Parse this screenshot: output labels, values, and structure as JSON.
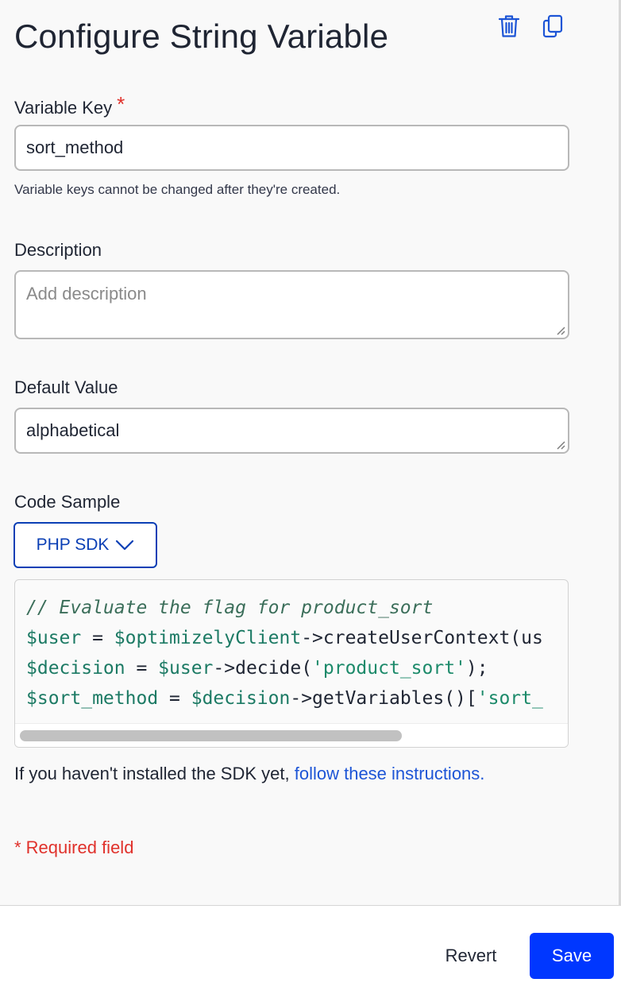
{
  "header": {
    "title": "Configure String Variable",
    "delete_icon": "trash-icon",
    "copy_icon": "copy-icon"
  },
  "variable_key": {
    "label": "Variable Key",
    "required_marker": "*",
    "value": "sort_method",
    "help_text": "Variable keys cannot be changed after they're created."
  },
  "description": {
    "label": "Description",
    "placeholder": "Add description"
  },
  "default_value": {
    "label": "Default Value",
    "value": "alphabetical"
  },
  "code_sample": {
    "label": "Code Sample",
    "sdk_selected": "PHP SDK",
    "lines": [
      [
        {
          "t": "c",
          "text": "// Evaluate the flag for product_sort"
        }
      ],
      [
        {
          "t": "v",
          "text": "$user"
        },
        {
          "t": "p",
          "text": " = "
        },
        {
          "t": "v",
          "text": "$optimizelyClient"
        },
        {
          "t": "p",
          "text": "->createUserContext(us"
        }
      ],
      [
        {
          "t": "v",
          "text": "$decision"
        },
        {
          "t": "p",
          "text": " = "
        },
        {
          "t": "v",
          "text": "$user"
        },
        {
          "t": "p",
          "text": "->decide("
        },
        {
          "t": "s",
          "text": "'product_sort'"
        },
        {
          "t": "p",
          "text": ");"
        }
      ],
      [
        {
          "t": "v",
          "text": "$sort_method"
        },
        {
          "t": "p",
          "text": " = "
        },
        {
          "t": "v",
          "text": "$decision"
        },
        {
          "t": "p",
          "text": "->getVariables()["
        },
        {
          "t": "s",
          "text": "'sort_"
        }
      ]
    ]
  },
  "install_note": {
    "text": "If you haven't installed the SDK yet, ",
    "link_text": "follow these instructions."
  },
  "required_note": "* Required field",
  "footer": {
    "revert_label": "Revert",
    "save_label": "Save"
  },
  "colors": {
    "primary": "#0037ff",
    "link": "#1d55d6",
    "required": "#e0312b",
    "dropdown_border": "#0b3fb5"
  }
}
